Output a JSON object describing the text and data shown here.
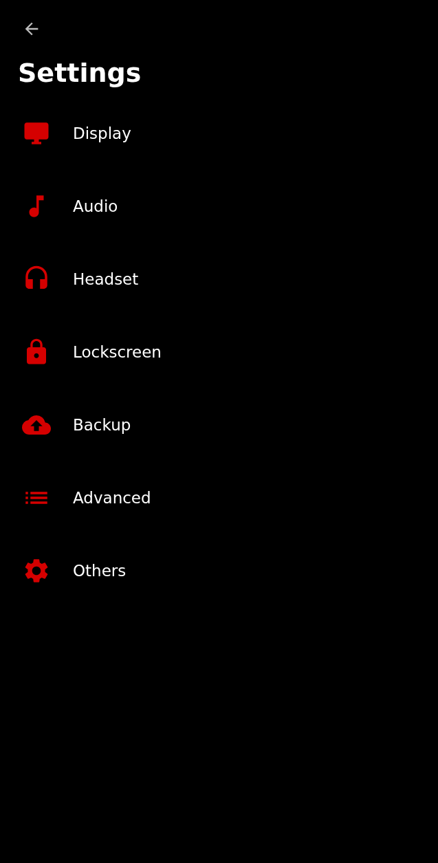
{
  "header": {
    "title": "Settings"
  },
  "items": [
    {
      "label": "Display"
    },
    {
      "label": "Audio"
    },
    {
      "label": "Headset"
    },
    {
      "label": "Lockscreen"
    },
    {
      "label": "Backup"
    },
    {
      "label": "Advanced"
    },
    {
      "label": "Others"
    }
  ]
}
